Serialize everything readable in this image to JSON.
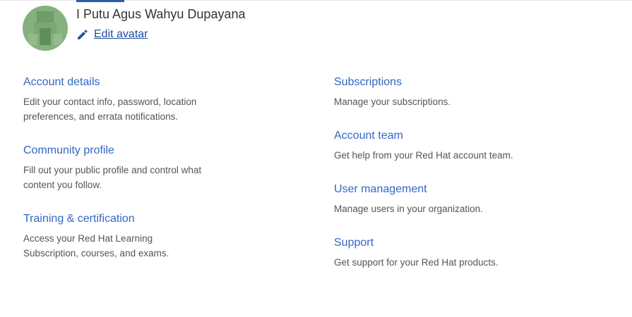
{
  "profile": {
    "name": "I Putu Agus Wahyu Dupayana",
    "edit_avatar_label": "Edit avatar"
  },
  "sections": {
    "account_details": {
      "title": "Account details",
      "description": "Edit your contact info, password, location preferences, and errata notifications."
    },
    "community_profile": {
      "title": "Community profile",
      "description": "Fill out your public profile and control what content you follow."
    },
    "training_certification": {
      "title": "Training & certification",
      "description": "Access your Red Hat Learning Subscription, courses, and exams."
    },
    "subscriptions": {
      "title": "Subscriptions",
      "description": "Manage your subscriptions."
    },
    "account_team": {
      "title": "Account team",
      "description": "Get help from your Red Hat account team."
    },
    "user_management": {
      "title": "User management",
      "description": "Manage users in your organization."
    },
    "support": {
      "title": "Support",
      "description": "Get support for your Red Hat products."
    }
  },
  "colors": {
    "link": "#3266c4",
    "edit_link": "#1f4fa0",
    "name_text": "#333333",
    "description_text": "#555555",
    "avatar_bg": "#86b07e"
  },
  "icons": {
    "edit": "pencil-icon"
  }
}
